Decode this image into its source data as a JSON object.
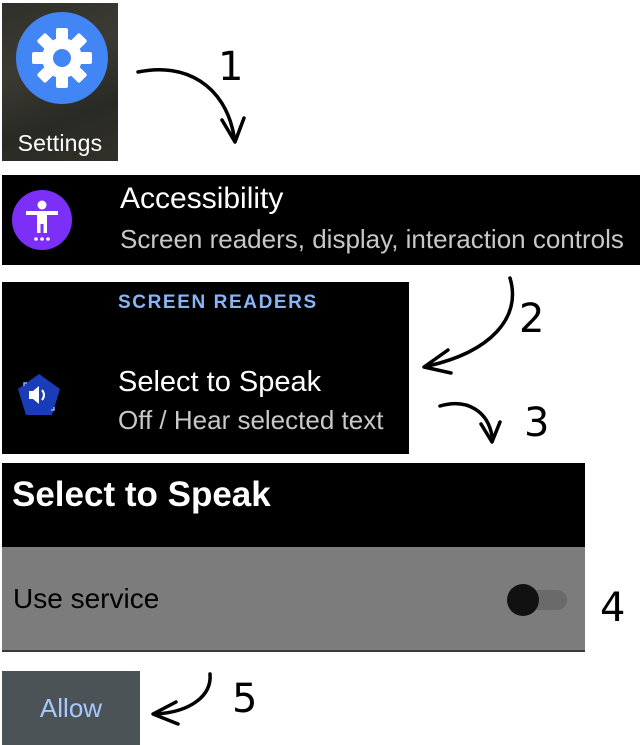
{
  "settings_tile": {
    "label": "Settings",
    "icon": "gear-icon",
    "icon_color": "#4285f4"
  },
  "accessibility_row": {
    "title": "Accessibility",
    "subtitle": "Screen readers, display, interaction controls",
    "icon": "accessibility-person-icon",
    "icon_color": "#7b2ff7"
  },
  "screen_readers_panel": {
    "section_header": "SCREEN READERS",
    "item_title": "Select to Speak",
    "item_subtitle": "Off / Hear selected text",
    "icon": "select-to-speak-icon",
    "accent": "#8ab4f8"
  },
  "select_to_speak_page": {
    "title": "Select to Speak",
    "use_service_label": "Use service",
    "toggle_state": "off"
  },
  "dialog": {
    "allow_label": "Allow"
  },
  "steps": [
    "1",
    "2",
    "3",
    "4",
    "5"
  ]
}
